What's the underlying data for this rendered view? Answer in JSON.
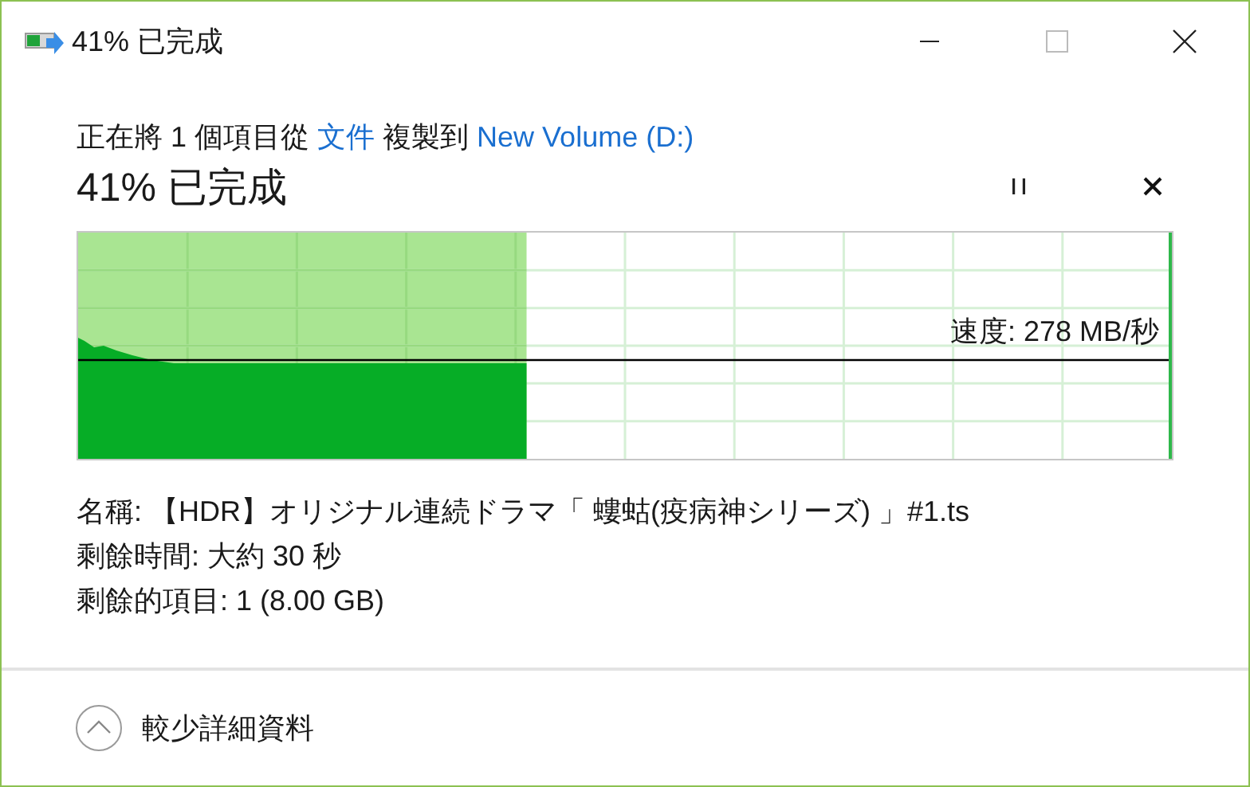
{
  "window": {
    "title": "41% 已完成"
  },
  "description": [
    {
      "kind": "plain",
      "text": "正在將 1 個項目從 "
    },
    {
      "kind": "link",
      "text": "文件"
    },
    {
      "kind": "plain",
      "text": " 複製到 "
    },
    {
      "kind": "link",
      "text": "New Volume (D:)"
    }
  ],
  "progress": {
    "title": "41% 已完成",
    "level": 0.41,
    "speed": "速度: 278 MB/秒"
  },
  "details": [
    "名稱: 【HDR】オリジナル連続ドラマ「 螻蛄(疫病神シリーズ) 」#1.ts",
    "剩餘時間: 大約 30 秒",
    "剩餘的項目: 1 (8.00 GB)"
  ],
  "footer": {
    "label": "較少詳細資料",
    "expanded": true
  }
}
